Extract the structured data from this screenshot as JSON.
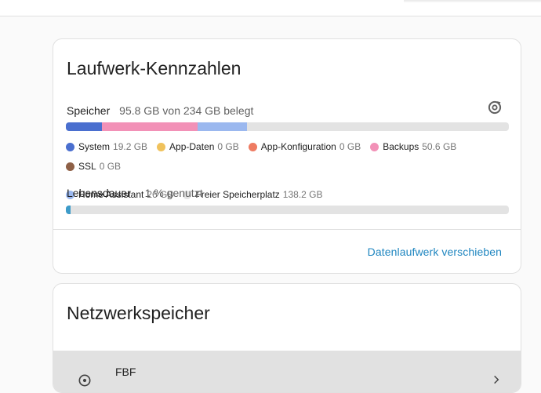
{
  "disk_card": {
    "title": "Laufwerk-Kennzahlen",
    "storage_label": "Speicher",
    "storage_value": "95.8 GB von 234 GB belegt",
    "storage_bar": [
      {
        "name": "System",
        "fraction": 0.082,
        "color": "#4a6fcf"
      },
      {
        "name": "Backups",
        "fraction": 0.216,
        "color": "#f291b7"
      },
      {
        "name": "Home Assistant",
        "fraction": 0.111,
        "color": "#9bb8ef"
      }
    ],
    "legend": [
      {
        "name": "System",
        "size": "19.2 GB",
        "color": "#4a6fcf"
      },
      {
        "name": "App-Daten",
        "size": "0 GB",
        "color": "#f0c25c"
      },
      {
        "name": "App-Konfiguration",
        "size": "0 GB",
        "color": "#ee7b62"
      },
      {
        "name": "Backups",
        "size": "50.6 GB",
        "color": "#f291b7"
      },
      {
        "name": "SSL",
        "size": "0 GB",
        "color": "#8e6046"
      },
      {
        "name": "Home Assistant",
        "size": "26 GB",
        "color": "#9bb8ef"
      },
      {
        "name": "Freier Speicherplatz",
        "size": "138.2 GB",
        "color": "#e3e3e3"
      }
    ],
    "lifetime_label": "Lebensdauer",
    "lifetime_value": "1 % genutzt",
    "lifetime_fraction": 0.01,
    "lifetime_color": "#3d9bc9",
    "action_label": "Datenlaufwerk verschieben",
    "refresh_icon": "refresh-icon"
  },
  "network_card": {
    "title": "Netzwerkspeicher",
    "item": {
      "name": "FBF",
      "icon": "network-share-icon",
      "chevron": "chevron-right-icon"
    }
  }
}
